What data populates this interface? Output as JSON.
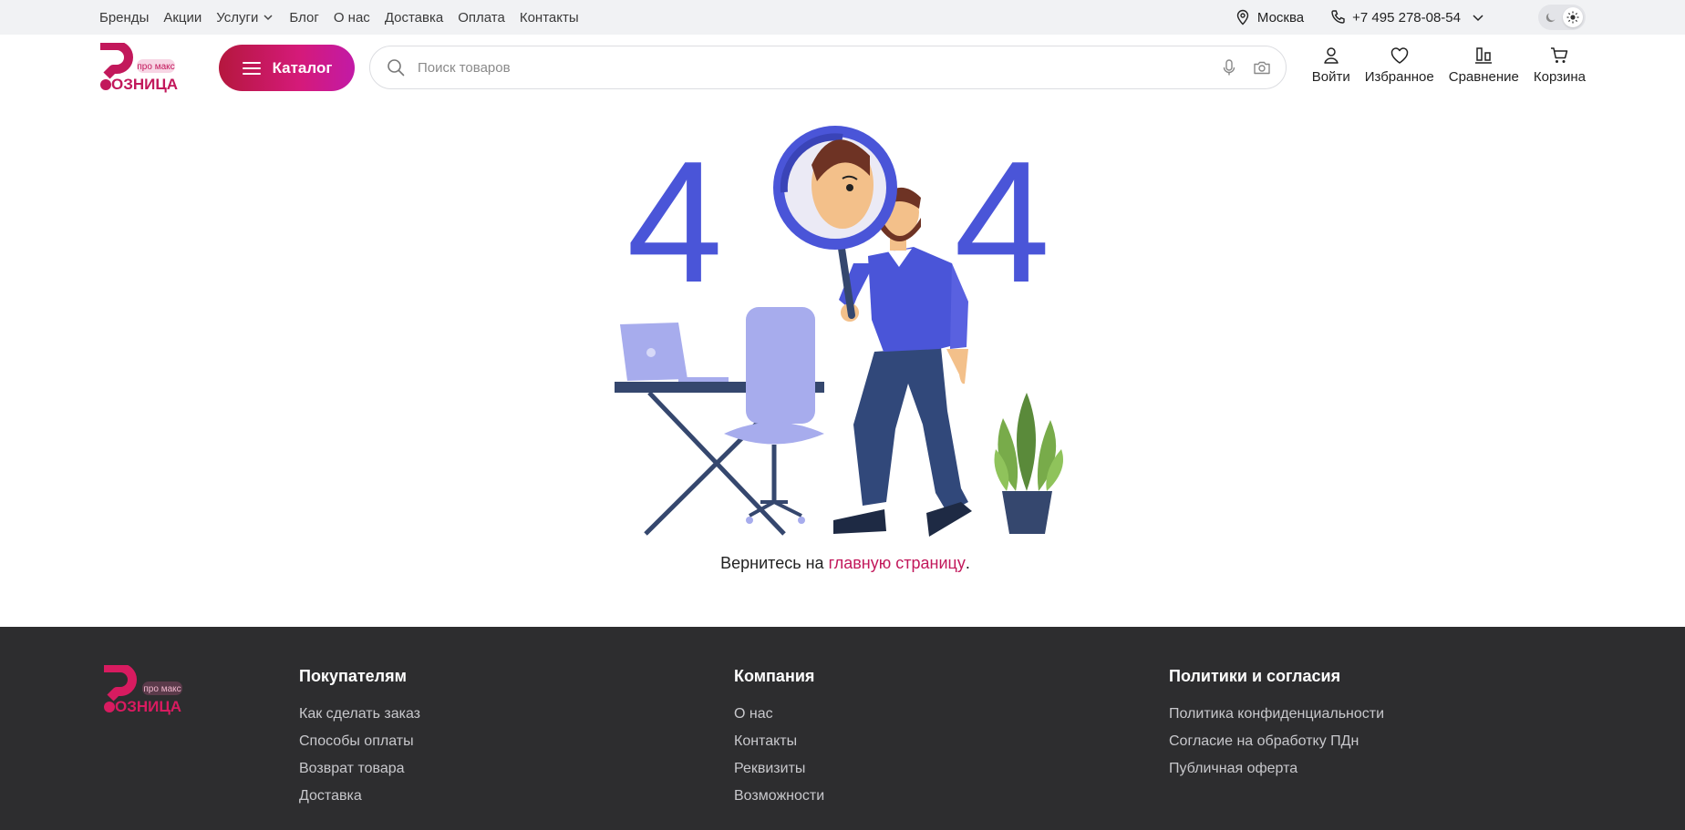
{
  "topbar": {
    "nav": [
      {
        "label": "Бренды"
      },
      {
        "label": "Акции"
      },
      {
        "label": "Услуги"
      },
      {
        "label": "Блог"
      },
      {
        "label": "О нас"
      },
      {
        "label": "Доставка"
      },
      {
        "label": "Оплата"
      },
      {
        "label": "Контакты"
      }
    ],
    "city": "Москва",
    "phone": "+7 495 278-08-54"
  },
  "header": {
    "logo": {
      "main": "ОЗНИЦА",
      "tag": "про макс"
    },
    "catalog_label": "Каталог",
    "search_placeholder": "Поиск товаров",
    "actions": {
      "login": "Войти",
      "favorites": "Избранное",
      "compare": "Сравнение",
      "cart": "Корзина"
    }
  },
  "main": {
    "illustration_left_digit": "4",
    "illustration_right_digit": "4",
    "return_prefix": "Вернитесь на",
    "return_link": "главную страницу",
    "return_suffix": "."
  },
  "footer": {
    "columns": [
      {
        "title": "Покупателям",
        "links": [
          "Как сделать заказ",
          "Способы оплаты",
          "Возврат товара",
          "Доставка"
        ]
      },
      {
        "title": "Компания",
        "links": [
          "О нас",
          "Контакты",
          "Реквизиты",
          "Возможности"
        ]
      },
      {
        "title": "Политики и согласия",
        "links": [
          "Политика конфиденциальности",
          "Согласие на обработку ПДн",
          "Публичная оферта"
        ]
      }
    ]
  },
  "colors": {
    "brand": "#c2185b",
    "illustration_blue": "#4a55d8",
    "footer_bg": "#2d2d2f"
  }
}
